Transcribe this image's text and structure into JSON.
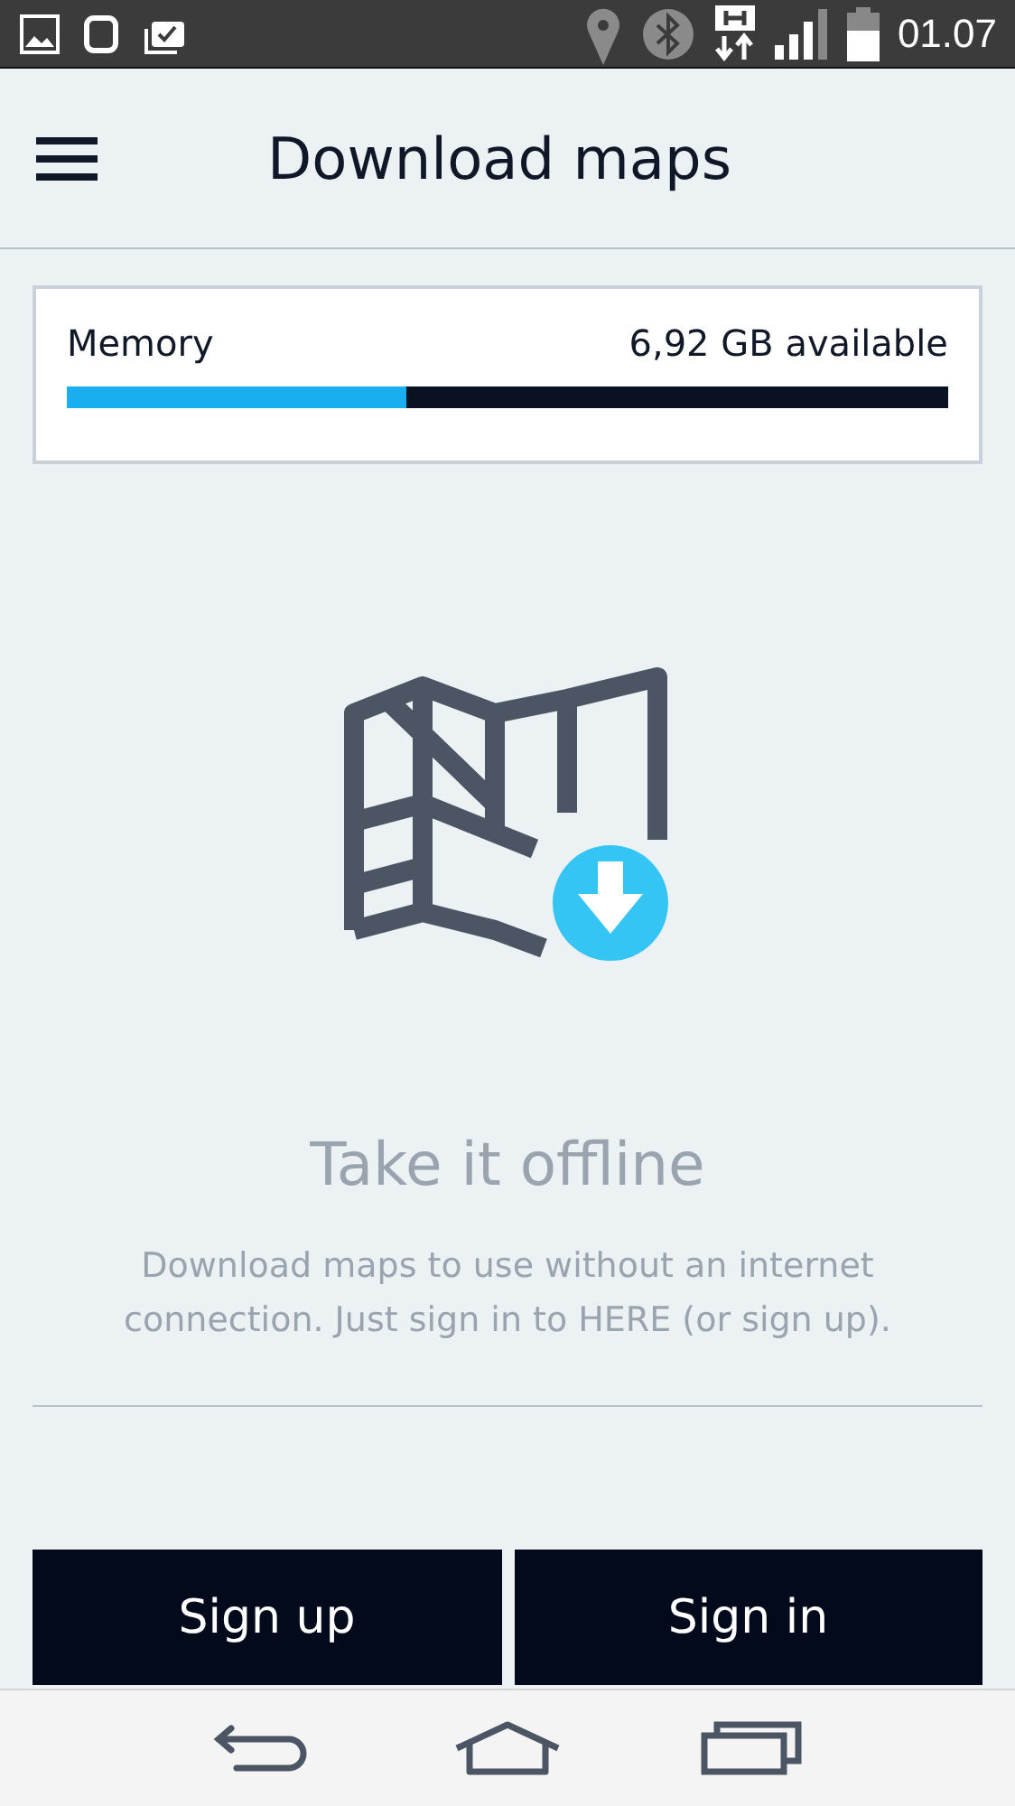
{
  "status_bar": {
    "time": "01.07"
  },
  "header": {
    "title": "Download maps"
  },
  "memory": {
    "label": "Memory",
    "reading": "6,92 GB available",
    "level": 0.386
  },
  "empty_state": {
    "title": "Take it offline",
    "message": "Download maps to use without an internet connection. Just sign in to HERE (or sign up)."
  },
  "buttons": [
    {
      "label": "Sign up"
    },
    {
      "label": "Sign in"
    }
  ]
}
